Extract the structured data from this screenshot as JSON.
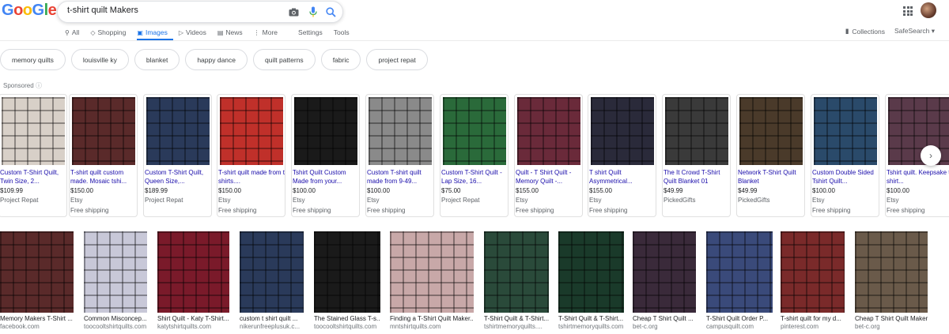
{
  "search": {
    "query": "t-shirt quilt Makers"
  },
  "logo": {
    "letters": [
      "G",
      "o",
      "g",
      "l",
      "e"
    ]
  },
  "nav": {
    "tabs": [
      {
        "label": "All",
        "icon": "search-icon"
      },
      {
        "label": "Shopping",
        "icon": "tag-icon"
      },
      {
        "label": "Images",
        "icon": "image-icon",
        "active": true
      },
      {
        "label": "Videos",
        "icon": "play-icon"
      },
      {
        "label": "News",
        "icon": "news-icon"
      },
      {
        "label": "More",
        "icon": "more-icon"
      }
    ],
    "settings": "Settings",
    "tools": "Tools",
    "collections": "Collections",
    "safesearch": "SafeSearch ▾"
  },
  "chips": [
    "memory quilts",
    "louisville ky",
    "blanket",
    "happy dance",
    "quilt patterns",
    "fabric",
    "project repat"
  ],
  "sponsored": "Sponsored",
  "products": [
    {
      "title": "Custom T-Shirt Quilt, Twin Size, 2...",
      "price": "$109.99",
      "seller": "Project Repat",
      "shipping": "",
      "color": "#d8d0c8"
    },
    {
      "title": "T-shirt quilt custom made. Mosaic tshi...",
      "price": "$150.00",
      "seller": "Etsy",
      "shipping": "Free shipping",
      "color": "#5a2a2a"
    },
    {
      "title": "Custom T-Shirt Quilt, Queen Size,...",
      "price": "$189.99",
      "seller": "Project Repat",
      "shipping": "",
      "color": "#2a3a5a"
    },
    {
      "title": "T-shirt quilt made from t shirts....",
      "price": "$150.00",
      "seller": "Etsy",
      "shipping": "Free shipping",
      "color": "#c0302a"
    },
    {
      "title": "Tshirt Quilt Custom Made from your...",
      "price": "$100.00",
      "seller": "Etsy",
      "shipping": "Free shipping",
      "color": "#1a1a1a"
    },
    {
      "title": "Custom T-shirt quilt made from 9-49...",
      "price": "$100.00",
      "seller": "Etsy",
      "shipping": "Free shipping",
      "color": "#8a8a8a"
    },
    {
      "title": "Custom T-Shirt Quilt - Lap Size, 16...",
      "price": "$75.00",
      "seller": "Project Repat",
      "shipping": "",
      "color": "#2a6a3a"
    },
    {
      "title": "Quilt - T Shirt Quilt - Memory Quilt -...",
      "price": "$155.00",
      "seller": "Etsy",
      "shipping": "Free shipping",
      "color": "#6a2a3a"
    },
    {
      "title": "T shirt Quilt Asymmetrical...",
      "price": "$155.00",
      "seller": "Etsy",
      "shipping": "Free shipping",
      "color": "#2a2a3a"
    },
    {
      "title": "The It Crowd T-Shirt Quilt Blanket 01",
      "price": "$49.99",
      "seller": "PickedGifts",
      "shipping": "",
      "color": "#3a3a3a"
    },
    {
      "title": "Network T-Shirt Quilt Blanket",
      "price": "$49.99",
      "seller": "PickedGifts",
      "shipping": "",
      "color": "#4a3a2a"
    },
    {
      "title": "Custom Double Sided Tshirt Quilt...",
      "price": "$100.00",
      "seller": "Etsy",
      "shipping": "Free shipping",
      "color": "#2a4a6a"
    },
    {
      "title": "Tshirt quilt. Keepsake t-shirt...",
      "price": "$100.00",
      "seller": "Etsy",
      "shipping": "Free shipping",
      "color": "#5a3a4a"
    }
  ],
  "results": [
    {
      "title": "Memory Makers T-Shirt ...",
      "source": "facebook.com",
      "color": "#5a2a2a"
    },
    {
      "title": "Common Misconcep...",
      "source": "toocooltshirtquilts.com",
      "color": "#c8c8d8"
    },
    {
      "title": "Shirt Quilt - Katy T-Shirt...",
      "source": "katytshirtquilts.com",
      "color": "#7a1a2a"
    },
    {
      "title": "custom t shirt quilt ...",
      "source": "nikerunfreeplusuk.c...",
      "color": "#2a3a5a"
    },
    {
      "title": "The Stained Glass T-s...",
      "source": "toocooltshirtquilts.com",
      "color": "#1a1a1a"
    },
    {
      "title": "Finding a T-Shirt Quilt Maker...",
      "source": "mntshirtquilts.com",
      "color": "#c8a8a8"
    },
    {
      "title": "T-Shirt Quilt & T-Shirt...",
      "source": "tshirtmemoryquilts....",
      "color": "#2a4a3a"
    },
    {
      "title": "T-Shirt Quilt & T-Shirt...",
      "source": "tshirtmemoryquilts.com",
      "color": "#1a3a2a"
    },
    {
      "title": "Cheap T Shirt Quilt ...",
      "source": "bet-c.org",
      "color": "#3a2a3a"
    },
    {
      "title": "T-Shirt Quilt Order P...",
      "source": "campusquilt.com",
      "color": "#3a4a7a"
    },
    {
      "title": "T-shirt quilt for my d...",
      "source": "pinterest.com",
      "color": "#7a2a2a"
    },
    {
      "title": "Cheap T Shirt Quilt Makers | ...",
      "source": "bet-c.org",
      "color": "#6a5a4a"
    }
  ]
}
